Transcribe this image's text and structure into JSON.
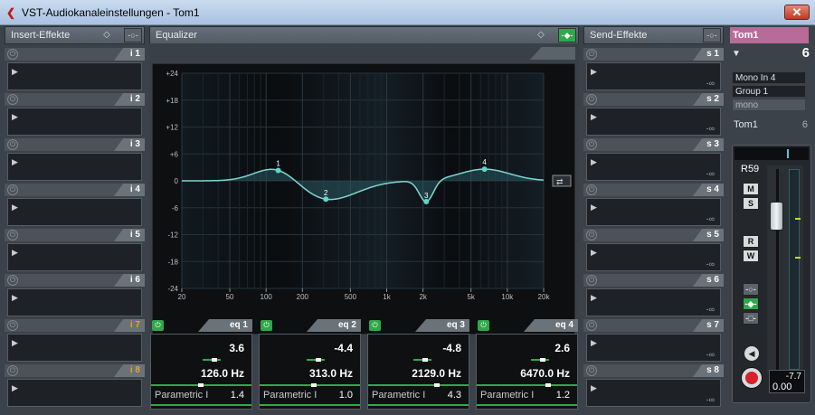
{
  "window": {
    "title": "VST-Audiokanaleinstellungen - Tom1",
    "close": "✕"
  },
  "insert": {
    "header": "Insert-Effekte",
    "slots": [
      "i 1",
      "i 2",
      "i 3",
      "i 4",
      "i 5",
      "i 6",
      "i 7",
      "i 8"
    ]
  },
  "equalizer": {
    "header": "Equalizer",
    "y_ticks": [
      "+24",
      "+18",
      "+12",
      "+6",
      "0",
      "-6",
      "-12",
      "-18",
      "-24"
    ],
    "x_ticks": [
      "20",
      "50",
      "100",
      "200",
      "500",
      "1k",
      "2k",
      "5k",
      "10k",
      "20k"
    ],
    "points": [
      "1",
      "2",
      "3",
      "4"
    ],
    "bands": [
      {
        "label": "eq 1",
        "gain": "3.6",
        "freq": "126.0 Hz",
        "type": "Parametric I",
        "q": "1.4"
      },
      {
        "label": "eq 2",
        "gain": "-4.4",
        "freq": "313.0 Hz",
        "type": "Parametric I",
        "q": "1.0"
      },
      {
        "label": "eq 3",
        "gain": "-4.8",
        "freq": "2129.0 Hz",
        "type": "Parametric I",
        "q": "4.3"
      },
      {
        "label": "eq 4",
        "gain": "2.6",
        "freq": "6470.0 Hz",
        "type": "Parametric I",
        "q": "1.2"
      }
    ]
  },
  "sends": {
    "header": "Send-Effekte",
    "slots": [
      "s 1",
      "s 2",
      "s 3",
      "s 4",
      "s 5",
      "s 6",
      "s 7",
      "s 8"
    ],
    "value": "-∞"
  },
  "channel": {
    "name": "Tom1",
    "number": "6",
    "input": "Mono In 4",
    "output": "Group 1",
    "mode": "mono",
    "label": "Tom1",
    "label_num": "6",
    "preset": "R59",
    "m": "M",
    "s": "S",
    "r": "R",
    "w": "W",
    "level": "-7.7",
    "volume": "0.00"
  }
}
